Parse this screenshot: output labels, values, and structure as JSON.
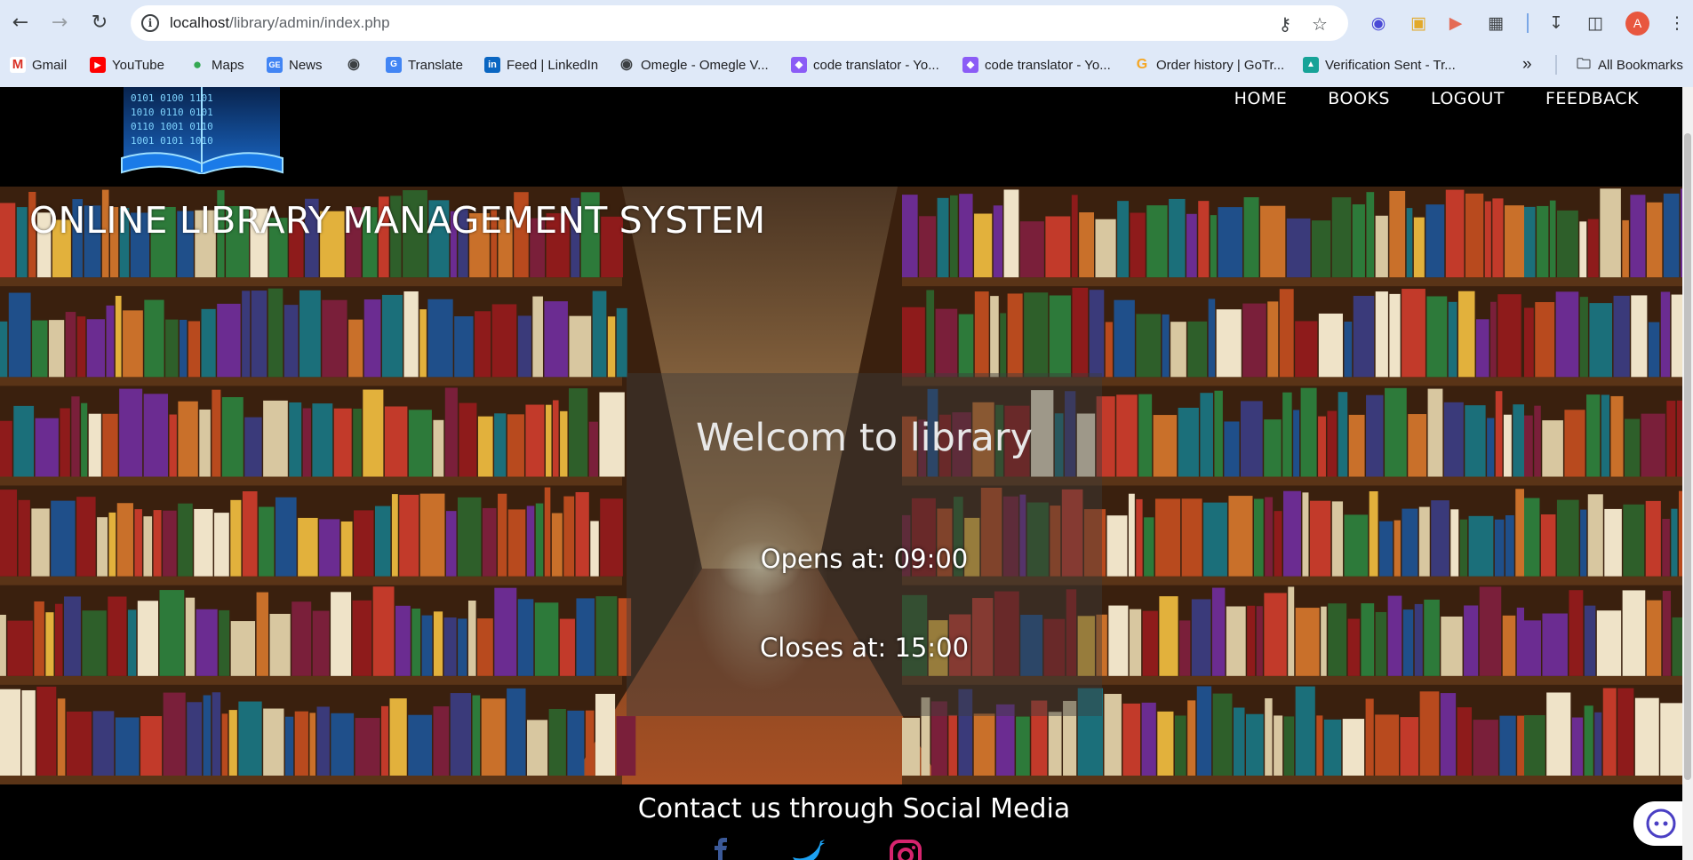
{
  "browser": {
    "url_host": "localhost",
    "url_path": "/library/admin/index.php",
    "avatar_letter": "A",
    "bookmarks": [
      {
        "label": "Gmail"
      },
      {
        "label": "YouTube"
      },
      {
        "label": "Maps"
      },
      {
        "label": "News"
      },
      {
        "label": ""
      },
      {
        "label": "Translate"
      },
      {
        "label": "Feed | LinkedIn"
      },
      {
        "label": "Omegle - Omegle V..."
      },
      {
        "label": "code translator - Yo..."
      },
      {
        "label": "code translator - Yo..."
      },
      {
        "label": "Order history | GoTr..."
      },
      {
        "label": "Verification Sent - Tr..."
      }
    ],
    "more_bookmarks": "»",
    "all_bookmarks": "All Bookmarks"
  },
  "nav": {
    "home": "HOME",
    "books": "BOOKS",
    "logout": "LOGOUT",
    "feedback": "FEEDBACK"
  },
  "hero": {
    "site_title": "ONLINE LIBRARY MANAGEMENT SYSTEM",
    "welcome": "Welcom to library",
    "opens": "Opens at: 09:00",
    "closes": "Closes at: 15:00"
  },
  "footer": {
    "contact": "Contact us through Social Media"
  },
  "colors": {
    "header_bg": "#000000",
    "browser_bg": "#dfe9f8",
    "facebook": "#3b5998",
    "twitter": "#1da1f2",
    "instagram": "#d6246e"
  }
}
